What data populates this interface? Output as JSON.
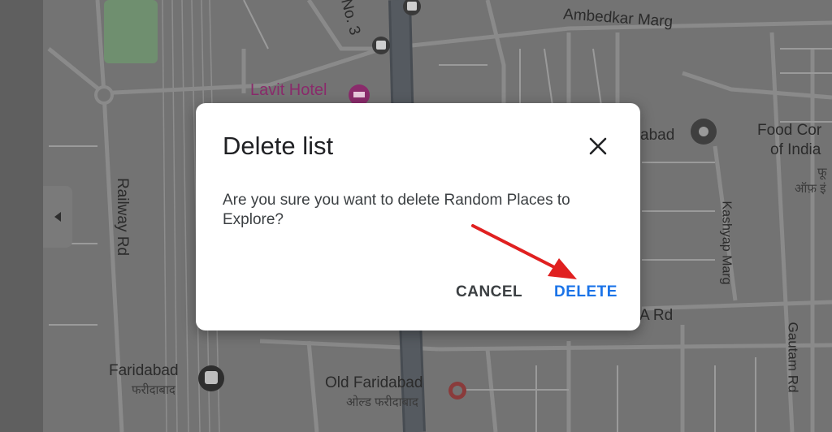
{
  "map": {
    "labels": {
      "ambedkar_marg": "Ambedkar Marg",
      "road_no3": "No. 3",
      "lavit_hotel": "Lavit Hotel",
      "railway_rd": "Railway Rd",
      "faridabad_partial": "abad",
      "food_corp": "Food Cor",
      "of_india": "of India",
      "hindi_fu": "फू",
      "hindi_of": "ऑफ़ इं",
      "kashyap_marg": "Kashyap Marg",
      "a_rd": "A Rd",
      "gautam_rd": "Gautam Rd",
      "faridabad_station": "Faridabad",
      "faridabad_station_hi": "फरीदाबाद",
      "old_faridabad": "Old Faridabad",
      "old_faridabad_hi": "ओल्ड फरीदाबाद"
    },
    "colors": {
      "hotel": "#8a2b6b",
      "road": "#8a8a8a",
      "major_road": "#4a4f55",
      "park": "#6f8f6f"
    }
  },
  "dialog": {
    "title": "Delete list",
    "message": "Are you sure you want to delete Random Places to Explore?",
    "cancel_label": "CANCEL",
    "delete_label": "DELETE",
    "close_icon": "close-icon"
  },
  "annotation": {
    "color": "#e02020"
  }
}
